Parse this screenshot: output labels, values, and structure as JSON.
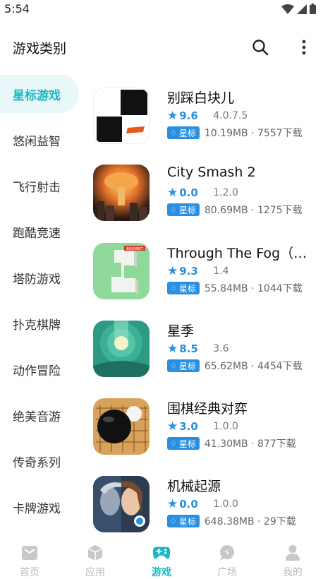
{
  "status_bar": {
    "time": "5:54"
  },
  "header": {
    "title": "游戏类别"
  },
  "sidebar": {
    "items": [
      {
        "label": "星标游戏"
      },
      {
        "label": "悠闲益智"
      },
      {
        "label": "飞行射击"
      },
      {
        "label": "跑酷竞速"
      },
      {
        "label": "塔防游戏"
      },
      {
        "label": "扑克棋牌"
      },
      {
        "label": "动作冒险"
      },
      {
        "label": "绝美音游"
      },
      {
        "label": "传奇系列"
      },
      {
        "label": "卡牌游戏"
      }
    ]
  },
  "apps": [
    {
      "name": "别踩白块儿",
      "rating": "9.6",
      "version": "4.0.7.5",
      "badge": "星标",
      "meta": "10.19MB · 7557下载"
    },
    {
      "name": "City Smash 2",
      "rating": "0.0",
      "version": "1.2.0",
      "badge": "星标",
      "meta": "80.69MB · 1275下载"
    },
    {
      "name": "Through The Fog（穿…",
      "rating": "9.3",
      "version": "1.4",
      "badge": "星标",
      "meta": "55.84MB · 1044下载",
      "icon_text": "BOOMBIT"
    },
    {
      "name": "星季",
      "rating": "8.5",
      "version": "3.6",
      "badge": "星标",
      "meta": "65.62MB · 4454下载"
    },
    {
      "name": "围棋经典对弈",
      "rating": "3.0",
      "version": "1.0.0",
      "badge": "星标",
      "meta": "41.30MB · 877下载"
    },
    {
      "name": "机械起源",
      "rating": "0.0",
      "version": "1.0.0",
      "badge": "星标",
      "meta": "648.38MB · 29下载"
    }
  ],
  "bottom_nav": {
    "items": [
      {
        "label": "首页"
      },
      {
        "label": "应用"
      },
      {
        "label": "游戏"
      },
      {
        "label": "广场"
      },
      {
        "label": "我的"
      }
    ]
  },
  "colors": {
    "accent": "#1ab7c4",
    "badge_blue": "#2a8fe0",
    "sidebar_active_bg": "#e8f7f8"
  }
}
